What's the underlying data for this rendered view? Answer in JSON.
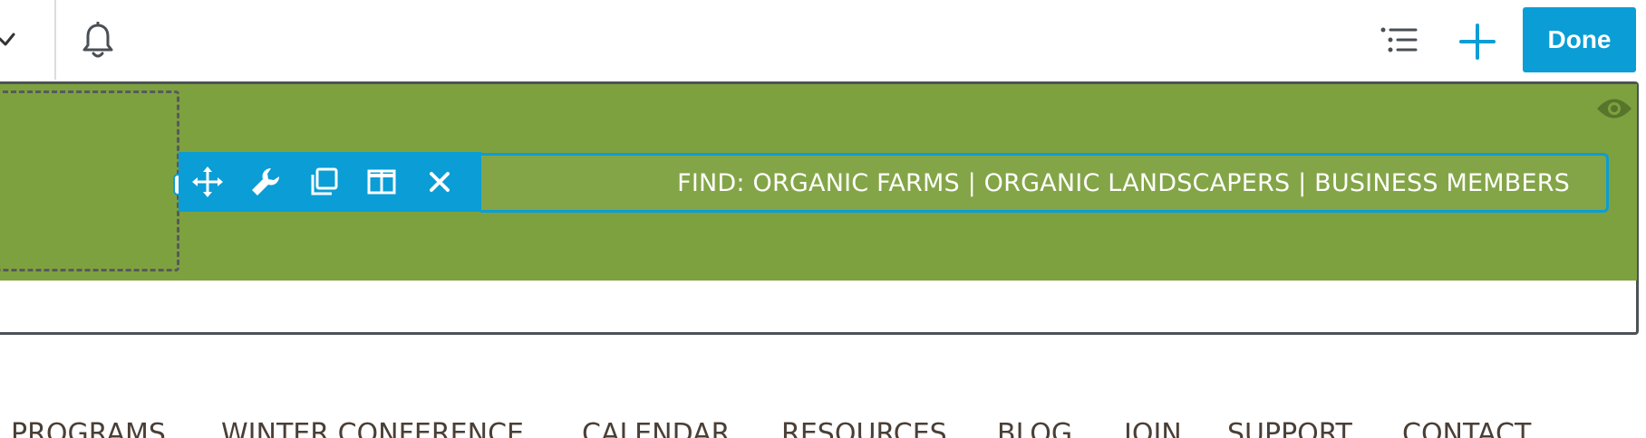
{
  "topbar": {
    "done_label": "Done",
    "icons": [
      "check-icon",
      "bell-icon",
      "outline-list-icon",
      "plus-icon"
    ],
    "accent_color": "#0a9dd6"
  },
  "section": {
    "background_color": "#7ea13f",
    "visibility_icon": "eye-icon"
  },
  "module_toolbar": {
    "tools": [
      "move-icon",
      "wrench-icon",
      "duplicate-icon",
      "columns-icon",
      "close-icon"
    ]
  },
  "text_module": {
    "text": "FIND: ORGANIC FARMS | ORGANIC LANDSCAPERS | BUSINESS MEMBERS"
  },
  "nav": {
    "items": [
      "PROGRAMS",
      "WINTER CONFERENCE",
      "CALENDAR",
      "RESOURCES",
      "BLOG",
      "JOIN",
      "SUPPORT",
      "CONTACT"
    ]
  }
}
